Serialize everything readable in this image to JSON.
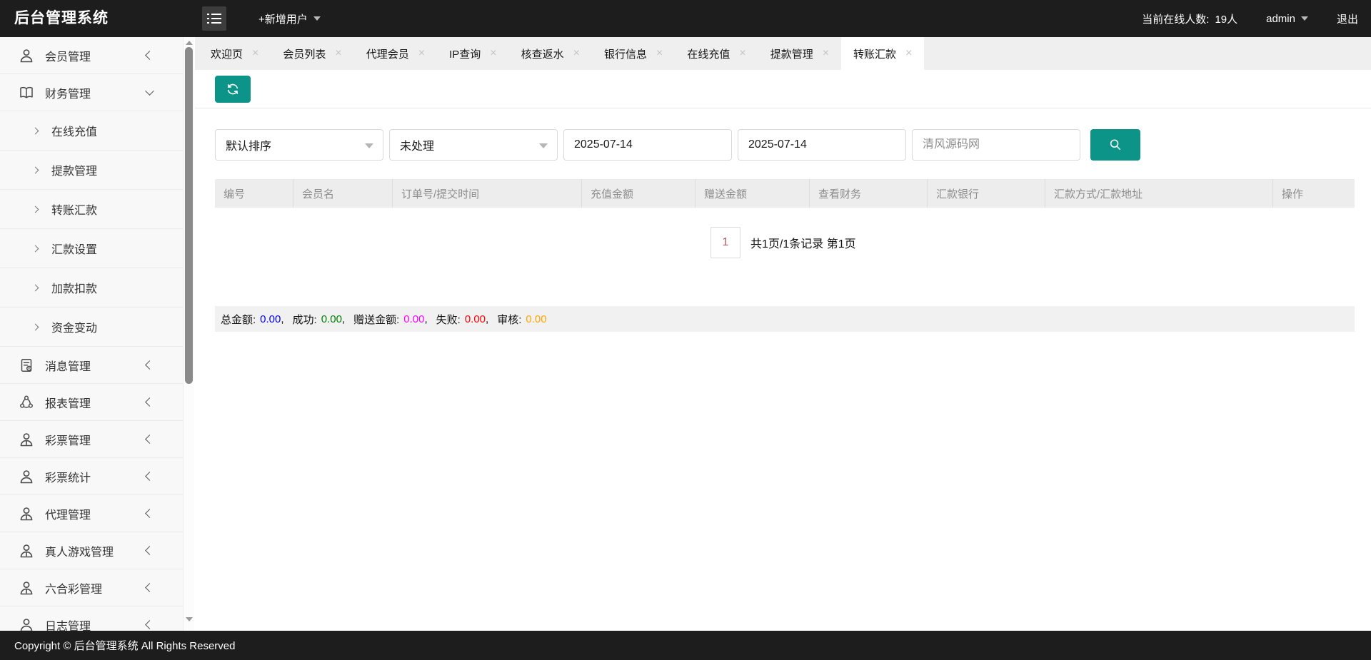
{
  "header": {
    "brand": "后台管理系统",
    "new_user": "+新增用户",
    "online_label": "当前在线人数:",
    "online_count": "19人",
    "username": "admin",
    "logout": "退出"
  },
  "sidebar": {
    "items": [
      {
        "label": "会员管理",
        "icon": "user-icon"
      },
      {
        "label": "财务管理",
        "icon": "book-icon",
        "expanded": true
      },
      {
        "label": "在线充值",
        "sub": true
      },
      {
        "label": "提款管理",
        "sub": true
      },
      {
        "label": "转账汇款",
        "sub": true
      },
      {
        "label": "汇款设置",
        "sub": true
      },
      {
        "label": "加款扣款",
        "sub": true
      },
      {
        "label": "资金变动",
        "sub": true
      },
      {
        "label": "消息管理",
        "icon": "message-icon"
      },
      {
        "label": "报表管理",
        "icon": "report-icon"
      },
      {
        "label": "彩票管理",
        "icon": "user-icon"
      },
      {
        "label": "彩票统计",
        "icon": "user-icon"
      },
      {
        "label": "代理管理",
        "icon": "user-icon"
      },
      {
        "label": "真人游戏管理",
        "icon": "user-icon"
      },
      {
        "label": "六合彩管理",
        "icon": "user-icon"
      },
      {
        "label": "日志管理",
        "icon": "user-icon"
      }
    ]
  },
  "tabs": [
    {
      "label": "欢迎页"
    },
    {
      "label": "会员列表"
    },
    {
      "label": "代理会员"
    },
    {
      "label": "IP查询"
    },
    {
      "label": "核查返水"
    },
    {
      "label": "银行信息"
    },
    {
      "label": "在线充值"
    },
    {
      "label": "提款管理"
    },
    {
      "label": "转账汇款",
      "active": true
    }
  ],
  "icons": {
    "close": "×"
  },
  "filters": {
    "sort": "默认排序",
    "status": "未处理",
    "date_from": "2025-07-14",
    "date_to": "2025-07-14",
    "keyword_placeholder": "清风源码网"
  },
  "table": {
    "columns": [
      "编号",
      "会员名",
      "订单号/提交时间",
      "充值金额",
      "赠送金额",
      "查看财务",
      "汇款银行",
      "汇款方式/汇款地址",
      "操作"
    ]
  },
  "pagination": {
    "page": "1",
    "page_color": "#b06060",
    "info": "共1页/1条记录 第1页"
  },
  "summary": {
    "comma": ",",
    "items": [
      {
        "label": "总金额:",
        "value": "0.00",
        "color": "#0000ff"
      },
      {
        "label": "成功:",
        "value": "0.00",
        "color": "#008000"
      },
      {
        "label": "赠送金额:",
        "value": "0.00",
        "color": "#ff00ff"
      },
      {
        "label": "失败:",
        "value": "0.00",
        "color": "#ff0000"
      },
      {
        "label": "审核:",
        "value": "0.00",
        "color": "#ffa500"
      }
    ]
  },
  "footer": {
    "copyright": "Copyright © 后台管理系统 All Rights Reserved"
  },
  "colors": {
    "accent": "#0d9488"
  }
}
